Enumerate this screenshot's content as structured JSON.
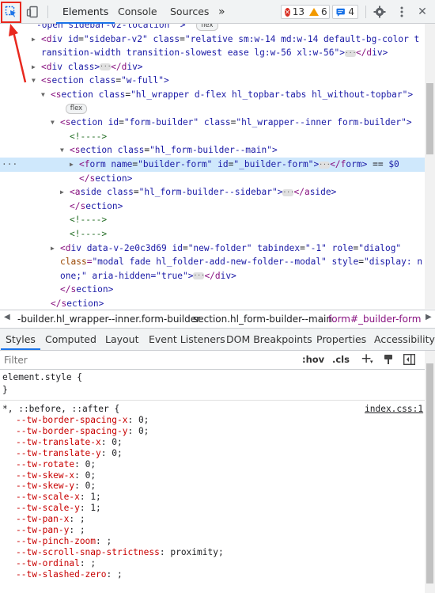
{
  "toolbar": {
    "tabs": [
      "Elements",
      "Console",
      "Sources"
    ],
    "more": "»",
    "errors": "13",
    "warnings": "6",
    "messages": "4"
  },
  "elements": {
    "lines": [
      {
        "i": 0,
        "t": "-open sidebar-v2-location \">",
        "pill": "flex",
        "top": "partial"
      },
      {
        "i": 1,
        "arrow": "▶",
        "html": "<div id=\"sidebar-v2\" class=\"relative sm:w-14 md:w-14 default-bg-color t"
      },
      {
        "i": 1,
        "html": "ransition-width transition-slowest ease lg:w-56 xl:w-56\">…</div>"
      },
      {
        "i": 1,
        "arrow": "▶",
        "html": "<div class>…</div>"
      },
      {
        "i": 1,
        "arrow": "▼",
        "html": "<section class=\"w-full\">"
      },
      {
        "i": 2,
        "arrow": "▼",
        "html": "<section class=\"hl_wrapper d-flex hl_topbar-tabs hl_without-topbar\">"
      },
      {
        "i": 3,
        "pill": "flex"
      },
      {
        "i": 3,
        "arrow": "▼",
        "html": "<section id=\"form-builder\" class=\"hl_wrapper--inner form-builder\">"
      },
      {
        "i": 4,
        "html": "<!---->"
      },
      {
        "i": 4,
        "arrow": "▼",
        "html": "<section class=\"hl_form-builder--main\">"
      },
      {
        "i": 5,
        "arrow": "▶",
        "html": "<form name=\"builder-form\" id=\"_builder-form\">…</form> == $0",
        "sel": true
      },
      {
        "i": 5,
        "html": "</section>"
      },
      {
        "i": 4,
        "arrow": "▶",
        "html": "<aside class=\"hl_form-builder--sidebar\">…</aside>"
      },
      {
        "i": 4,
        "html": "</section>"
      },
      {
        "i": 4,
        "html": "<!---->"
      },
      {
        "i": 4,
        "html": "<!---->"
      },
      {
        "i": 3,
        "arrow": "▶",
        "html": "<div data-v-2e0c3d69 id=\"new-folder\" tabindex=\"-1\" role=\"dialog\""
      },
      {
        "i": 3,
        "html": "class=\"modal fade hl_folder-add-new-folder--modal\" style=\"display: n"
      },
      {
        "i": 3,
        "html": "one;\" aria-hidden=\"true\">…</div>"
      },
      {
        "i": 3,
        "html": "</section>"
      },
      {
        "i": 2,
        "html": "</section>"
      }
    ]
  },
  "breadcrumb": {
    "items": [
      "-builder.hl_wrapper--inner.form-builder",
      "section.hl_form-builder--main",
      "form#_builder-form"
    ]
  },
  "subtabs": [
    "Styles",
    "Computed",
    "Layout",
    "Event Listeners",
    "DOM Breakpoints",
    "Properties",
    "Accessibility"
  ],
  "filter": {
    "placeholder": "Filter",
    "hov": ":hov",
    "cls": ".cls",
    "plus": "+"
  },
  "styles": {
    "element_style": "element.style {",
    "close": "}",
    "selector": "*, ::before, ::after {",
    "source": "index.css:1",
    "props": [
      [
        "--tw-border-spacing-x",
        "0;"
      ],
      [
        "--tw-border-spacing-y",
        "0;"
      ],
      [
        "--tw-translate-x",
        "0;"
      ],
      [
        "--tw-translate-y",
        "0;"
      ],
      [
        "--tw-rotate",
        "0;"
      ],
      [
        "--tw-skew-x",
        "0;"
      ],
      [
        "--tw-skew-y",
        "0;"
      ],
      [
        "--tw-scale-x",
        "1;"
      ],
      [
        "--tw-scale-y",
        "1;"
      ],
      [
        "--tw-pan-x",
        ";"
      ],
      [
        "--tw-pan-y",
        ";"
      ],
      [
        "--tw-pinch-zoom",
        ";"
      ],
      [
        "--tw-scroll-snap-strictness",
        "proximity;"
      ],
      [
        "--tw-ordinal",
        ";"
      ],
      [
        "--tw-slashed-zero",
        ";"
      ]
    ]
  },
  "colors": {
    "highlight_box": "#e8281e",
    "arrow": "#e8281e",
    "tab_underline": "#1a73e8"
  }
}
